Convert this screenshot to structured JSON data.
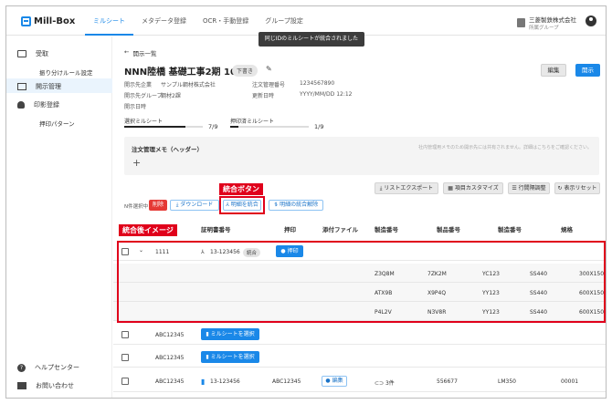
{
  "app": {
    "name": "Mill-Box"
  },
  "nav": [
    "ミルシート",
    "メタデータ登録",
    "OCR・手動登録",
    "グループ設定"
  ],
  "company": {
    "name": "三菱製鉄株式会社",
    "group": "所属グループ"
  },
  "toast": "同じIDのミルシートが統合されました",
  "sidebar": {
    "receive": "受取",
    "sort_rules": "振り分けルール設定",
    "open_manage": "開示管理",
    "stamp_register": "印影登録",
    "stamp_pattern": "押印パターン",
    "help": "ヘルプセンター",
    "contact": "お問い合わせ"
  },
  "page": {
    "back_label": "開示一覧",
    "title": "NNN陸橋 基礎工事2期 10月分",
    "draft_badge": "下書き",
    "meta": {
      "dest_company_label": "開示先企業",
      "dest_company_value": "サンプル鋼材株式会社",
      "order_no_label": "注文管理番号",
      "order_no_value": "1234567890",
      "dest_group_label": "開示先グループ",
      "dest_group_value": "鋼材2課",
      "updated_label": "更新日時",
      "updated_value": "YYYY/MM/DD 12:12",
      "open_date_label": "開示日時"
    },
    "edit_button": "編集",
    "open_button": "開示"
  },
  "progress": {
    "selected_label": "選択ミルシート",
    "selected_value": "7/9",
    "selected_fraction": 0.78,
    "stamped_label": "押印済ミルシート",
    "stamped_value": "1/9",
    "stamped_fraction": 0.11
  },
  "memo": {
    "title": "注文管理メモ（ヘッダー）",
    "note": "社内管理用メモのため開示先には共有されません。詳細はこちらをご確認ください。",
    "add": "+"
  },
  "toolbar": {
    "list_export": "リストエクスポート",
    "item_customize": "項目カスタマイズ",
    "row_spacing": "行間隔調整",
    "reset_view": "表示リセット"
  },
  "actions": {
    "selected_count": "N件選択中",
    "delete": "削除",
    "download": "ダウンロード",
    "merge": "明細を統合",
    "unmerge": "明細の統合解除"
  },
  "annotations": {
    "merge_button": "統合ボタン",
    "after_merge": "統合後イメージ"
  },
  "table": {
    "headers": {
      "cert_no": "証明書番号",
      "stamp": "押印",
      "attachment": "添付ファイル",
      "manufacture_no": "製造番号",
      "product_no": "製品番号",
      "production_no": "製造番号",
      "spec": "規格"
    },
    "merged_row": {
      "id": "1111",
      "cert": "13-123456",
      "merged_tag": "統合",
      "stamp_button": "押印"
    },
    "sub_rows": [
      {
        "a": "Z3Q8M",
        "b": "7ZK2M",
        "c": "YC123",
        "d": "SS440",
        "e": "300X150X"
      },
      {
        "a": "ATX9B",
        "b": "X9P4Q",
        "c": "YY123",
        "d": "SS440",
        "e": "600X150X"
      },
      {
        "a": "P4L2V",
        "b": "N3V8R",
        "c": "YY123",
        "d": "SS440",
        "e": "600X150X"
      }
    ],
    "rows": [
      {
        "id": "ABC12345",
        "select_button": "ミルシートを選択"
      },
      {
        "id": "ABC12345",
        "select_button": "ミルシートを選択"
      }
    ],
    "last_row": {
      "id": "ABC12345",
      "cert": "13-123456",
      "cert_id": "ABC12345",
      "edit_button": "編集",
      "attachments": "3件",
      "product_no": "556677",
      "production_no": "LM350",
      "spec": "00001"
    }
  }
}
